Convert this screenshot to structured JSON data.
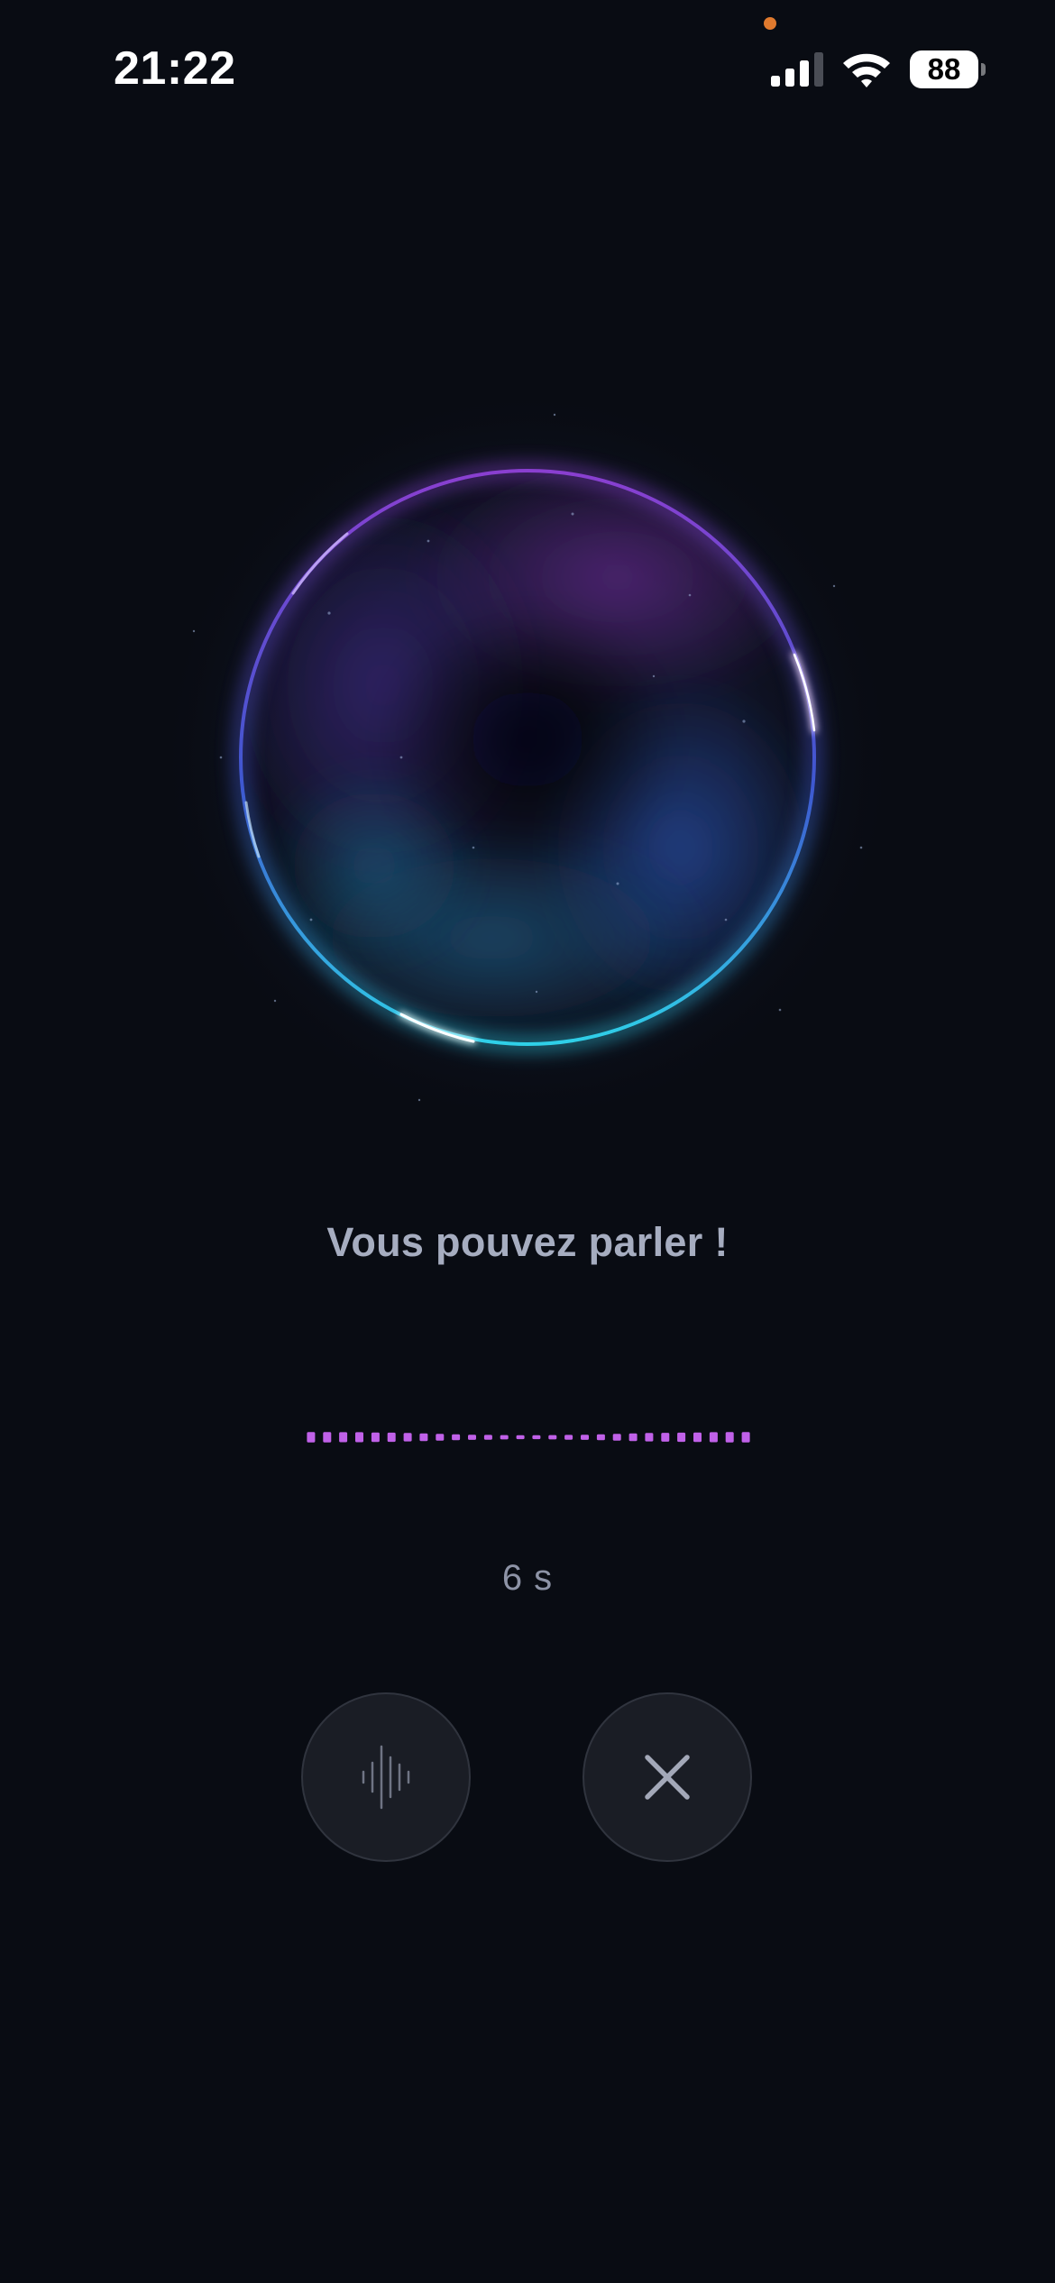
{
  "status_bar": {
    "time": "21:22",
    "battery_level": "88",
    "signal_bars_active": 3,
    "signal_bars_total": 4,
    "privacy_indicator_color": "#e07a2e"
  },
  "orb": {
    "colors": {
      "purple": "#8a3fd0",
      "blue": "#2f6fd8",
      "cyan": "#2fd0e8",
      "background": "#090c13"
    }
  },
  "prompt": {
    "text": "Vous pouvez parler !"
  },
  "level_meter": {
    "color": "#c061e8",
    "bar_count": 28,
    "levels": [
      0.95,
      0.95,
      0.9,
      0.9,
      0.85,
      0.8,
      0.7,
      0.6,
      0.5,
      0.4,
      0.3,
      0.25,
      0.2,
      0.15,
      0.15,
      0.2,
      0.25,
      0.3,
      0.4,
      0.5,
      0.6,
      0.7,
      0.75,
      0.8,
      0.85,
      0.9,
      0.95,
      0.95
    ]
  },
  "timer": {
    "text": "6 s"
  },
  "controls": {
    "voice_button_icon": "waveform-icon",
    "close_button_icon": "close-icon"
  }
}
